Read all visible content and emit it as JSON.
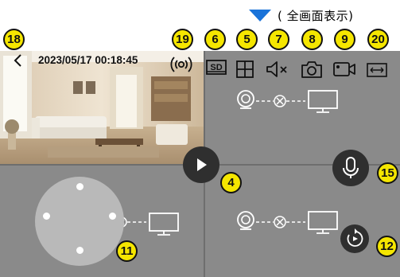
{
  "caption": {
    "text": "( 全画面表示)"
  },
  "callouts": {
    "c18": "18",
    "c19": "19",
    "c6": "6",
    "c5": "5",
    "c7": "7",
    "c8": "8",
    "c9": "9",
    "c20": "20",
    "c4": "4",
    "c15": "15",
    "c11": "11",
    "c12": "12"
  },
  "live_view": {
    "timestamp": "2023/05/17 00:18:45"
  },
  "toolbar": {
    "sd_label": "SD",
    "items": [
      "sd-quality",
      "split-view",
      "mute",
      "snapshot",
      "record",
      "fit-screen"
    ]
  },
  "icons": {
    "back": "chevron-left-icon",
    "signal": "signal-icon",
    "play": "play-icon",
    "mic": "microphone-icon",
    "rotate": "rotate-icon",
    "camera": "camera-device-icon",
    "monitor": "monitor-icon",
    "disconnected": "disconnected-x-icon"
  },
  "colors": {
    "caption_arrow": "#1a73d9",
    "callout_fill": "#f5e600",
    "panel_bg": "#8a8a8a",
    "button_bg": "#2f2f2f"
  }
}
